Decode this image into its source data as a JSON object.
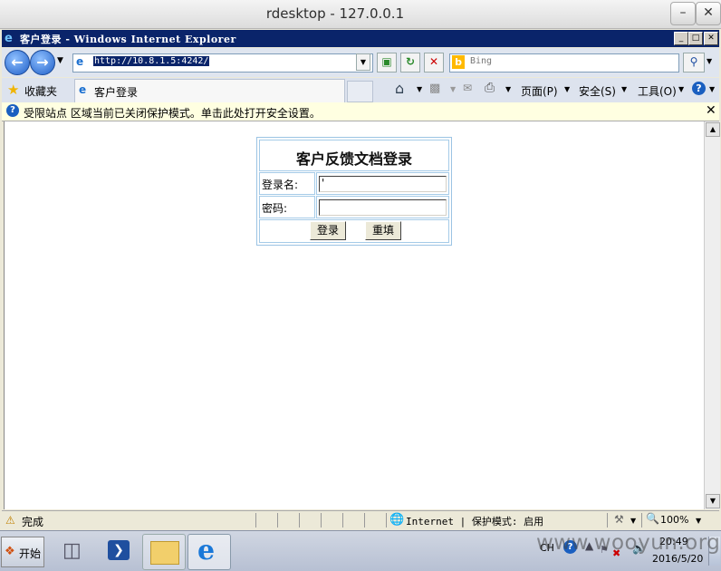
{
  "rdesktop": {
    "title": "rdesktop - 127.0.0.1",
    "min": "–",
    "close": "✕"
  },
  "ie": {
    "window_title": "客户登录 - Windows Internet Explorer",
    "address": "http://10.8.1.5:4242/",
    "search_placeholder": "Bing",
    "favorites": "收藏夹",
    "tab_title": "客户登录",
    "menu": {
      "page": "页面(P)",
      "safety": "安全(S)",
      "tools": "工具(O)"
    },
    "info_bar": "受限站点 区域当前已关闭保护模式。单击此处打开安全设置。",
    "status": {
      "done": "完成",
      "zone": "Internet | 保护模式: 启用",
      "zoom": "100%"
    }
  },
  "login": {
    "heading": "客户反馈文档登录",
    "username_label": "登录名:",
    "username_value": "'",
    "password_label": "密码:",
    "login_button": "登录",
    "reset_button": "重填"
  },
  "taskbar": {
    "start": "开始",
    "lang": "CH",
    "time": "20:49",
    "date": "2016/5/20"
  },
  "watermark": "www.wooyun.org"
}
